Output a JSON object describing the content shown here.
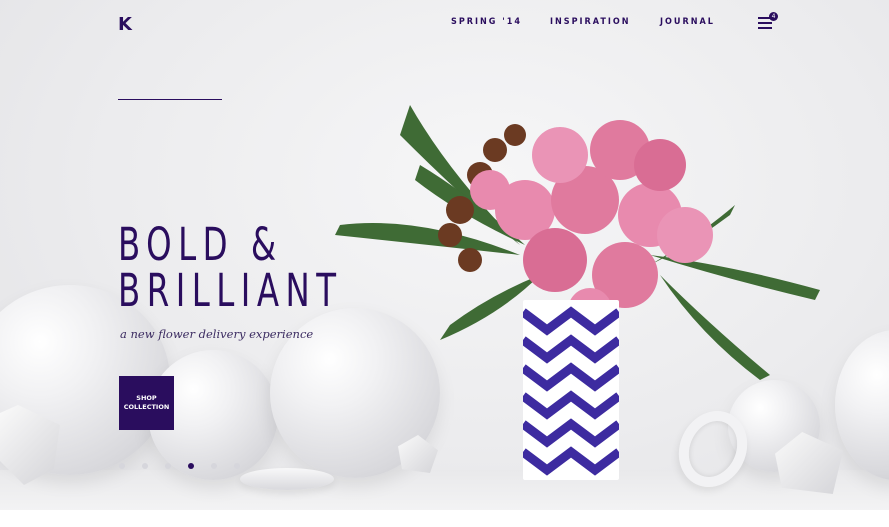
{
  "header": {
    "logo": "K",
    "nav": [
      "SPRING '14",
      "INSPIRATION",
      "JOURNAL"
    ],
    "cart_count": "4"
  },
  "hero": {
    "headline_line1": "BOLD &",
    "headline_line2": "BRILLIANT",
    "subline": "a new flower delivery experience",
    "cta_line1": "SHOP",
    "cta_line2": "COLLECTION",
    "slides_total": 6,
    "active_slide": 4
  },
  "colors": {
    "brand": "#2a0d5e",
    "background": "#ececee",
    "rose": "#e07a9e",
    "fern": "#3f6b35"
  },
  "icons": [
    "menu-icon",
    "cart-badge"
  ]
}
